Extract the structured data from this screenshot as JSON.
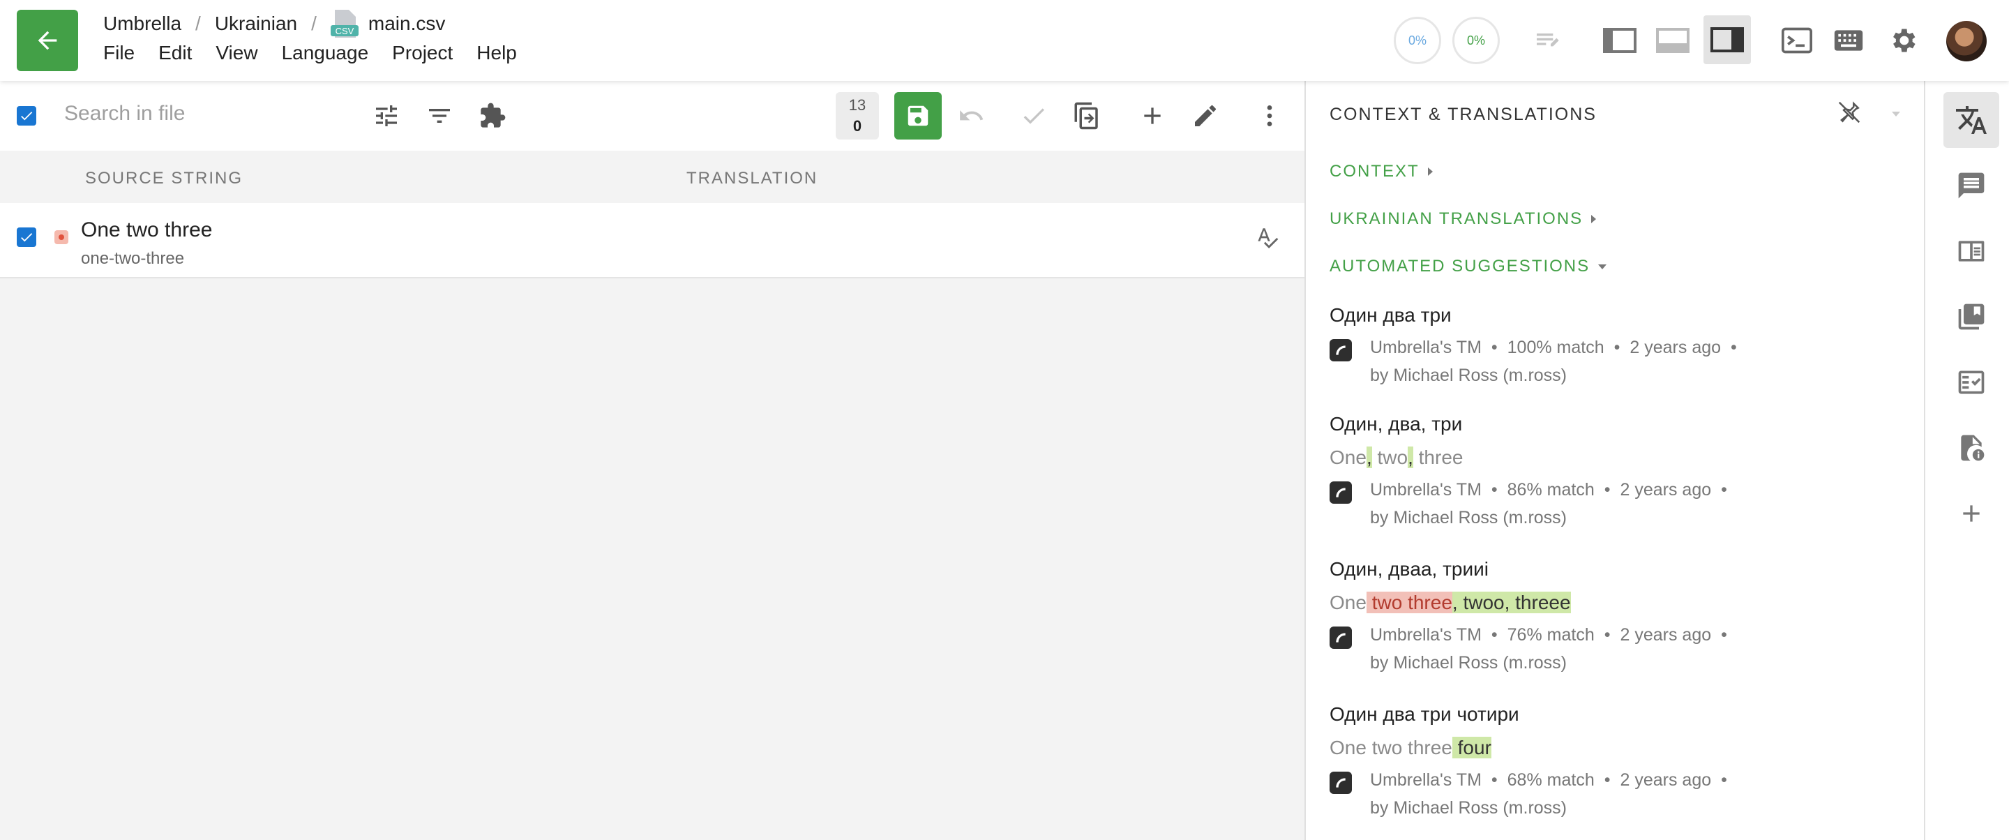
{
  "header": {
    "breadcrumb": [
      "Umbrella",
      "Ukrainian",
      "main.csv"
    ],
    "csv_badge": "CSV",
    "menus": [
      "File",
      "Edit",
      "View",
      "Language",
      "Project",
      "Help"
    ],
    "progress": [
      "0%",
      "0%"
    ],
    "icons": [
      "back-arrow-icon",
      "editor-icon",
      "layout-left-icon",
      "layout-bottom-icon",
      "layout-right-icon",
      "terminal-icon",
      "keyboard-icon",
      "gear-icon"
    ]
  },
  "toolbar": {
    "search_placeholder": "Search in file",
    "counter_top": "13",
    "counter_bottom": "0"
  },
  "table": {
    "columns": [
      "SOURCE STRING",
      "TRANSLATION"
    ],
    "rows": [
      {
        "title": "One two three",
        "key": "one-two-three"
      }
    ]
  },
  "panel": {
    "title": "CONTEXT & TRANSLATIONS",
    "sections": [
      "CONTEXT",
      "UKRAINIAN TRANSLATIONS",
      "AUTOMATED SUGGESTIONS"
    ],
    "suggestions": [
      {
        "title": "Один два три",
        "source": "Umbrella's TM",
        "match": "100% match",
        "time": "2 years ago",
        "author": "by Michael Ross (m.ross)"
      },
      {
        "title": "Один, два, три",
        "source": "Umbrella's TM",
        "match": "86% match",
        "time": "2 years ago",
        "author": "by Michael Ross (m.ross)",
        "diff": [
          "One",
          ",",
          " two",
          ",",
          " three"
        ]
      },
      {
        "title": "Один, двaa, трииi",
        "source": "Umbrella's TM",
        "match": "76% match",
        "time": "2 years ago",
        "author": "by Michael Ross (m.ross)",
        "diff": [
          "One",
          " two three",
          ", twoo, threee"
        ]
      },
      {
        "title": "Один два три чотири",
        "source": "Umbrella's TM",
        "match": "68% match",
        "time": "2 years ago",
        "author": "by Michael Ross (m.ross)",
        "diff": [
          "One two three",
          " four"
        ]
      }
    ]
  },
  "colors": {
    "accent": "#43a047",
    "checkbox": "#1976d2"
  }
}
